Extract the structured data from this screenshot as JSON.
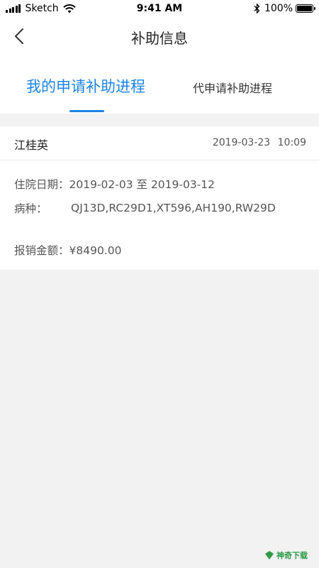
{
  "status_bar": {
    "carrier": "Sketch",
    "time": "9:41 AM",
    "battery": "100%"
  },
  "nav": {
    "title": "补助信息"
  },
  "tabs": [
    {
      "label": "我的申请补助进程",
      "active": true
    },
    {
      "label": "代申请补助进程",
      "active": false
    }
  ],
  "record": {
    "name": "江桂英",
    "datetime": "2019-03-23  10:09",
    "stay_label": "住院日期：",
    "stay_value": "2019-02-03 至 2019-03-12",
    "disease_label": "病种：",
    "disease_value": "QJ13D,RC29D1,XT596,AH190,RW29D",
    "amount_label": "报销金额：",
    "amount_value": "¥8490.00"
  },
  "watermark": "神奇下载",
  "colors": {
    "accent": "#1e84e6",
    "background": "#f2f2f2",
    "card": "#ffffff"
  }
}
